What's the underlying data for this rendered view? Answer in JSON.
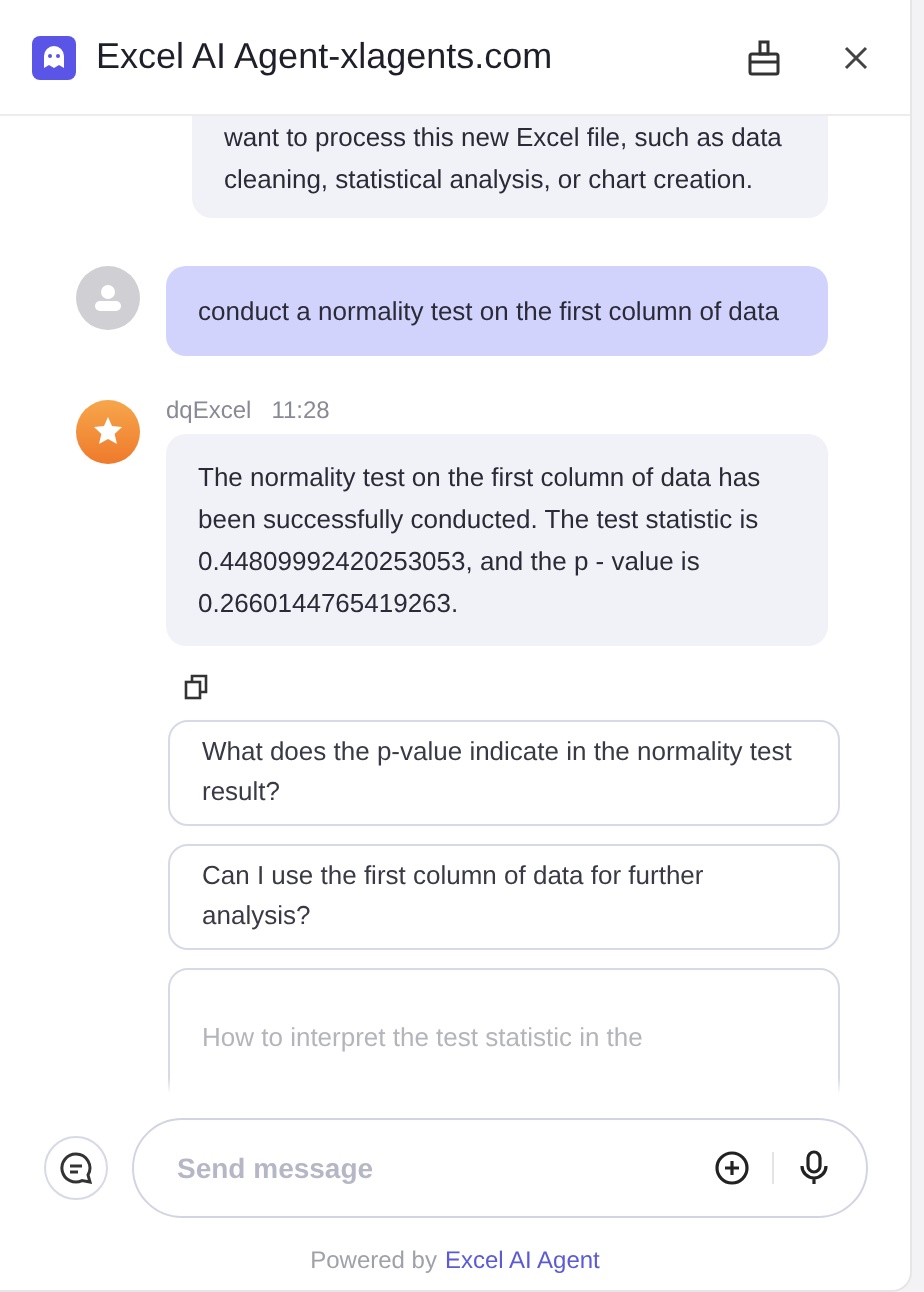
{
  "window": {
    "title": "Excel AI Agent-xlagents.com"
  },
  "messages": [
    {
      "kind": "assistant-partial",
      "text": "want to process this new Excel file, such as data cleaning, statistical analysis, or chart creation."
    },
    {
      "kind": "user",
      "text": "conduct a normality test on the first column of data"
    },
    {
      "kind": "assistant",
      "sender": "dqExcel",
      "time": "11:28",
      "text": "The normality test on the first column of data has been successfully conducted. The test statistic is 0.44809992420253053, and the p - value is 0.2660144765419263."
    }
  ],
  "suggestions": [
    "What does the p-value indicate in the normality test result?",
    "Can I use the first column of data for further analysis?",
    "How to interpret the test statistic in the"
  ],
  "composer": {
    "placeholder": "Send message"
  },
  "footer": {
    "prefix": "Powered by",
    "link": "Excel AI Agent"
  }
}
